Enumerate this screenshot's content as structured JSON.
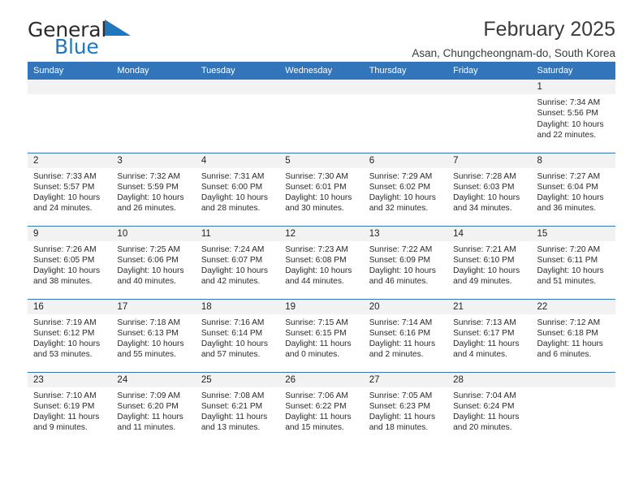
{
  "brand": {
    "name_part1": "General",
    "name_part2": "Blue",
    "triangle_color": "#1f77be",
    "text_color": "#2b2b2b"
  },
  "header": {
    "title": "February 2025",
    "subtitle": "Asan, Chungcheongnam-do, South Korea"
  },
  "theme": {
    "header_blue": "#3275bb",
    "daynum_bg": "#f2f2f2",
    "row_divider": "#3275bb",
    "text": "#2a2a2a"
  },
  "calendar": {
    "weekday_headers": [
      "Sunday",
      "Monday",
      "Tuesday",
      "Wednesday",
      "Thursday",
      "Friday",
      "Saturday"
    ],
    "labels": {
      "sunrise": "Sunrise:",
      "sunset": "Sunset:",
      "daylight": "Daylight:"
    },
    "weeks": [
      [
        {
          "day": "",
          "blank": true
        },
        {
          "day": "",
          "blank": true
        },
        {
          "day": "",
          "blank": true
        },
        {
          "day": "",
          "blank": true
        },
        {
          "day": "",
          "blank": true
        },
        {
          "day": "",
          "blank": true
        },
        {
          "day": "1",
          "sunrise": "Sunrise: 7:34 AM",
          "sunset": "Sunset: 5:56 PM",
          "daylight1": "Daylight: 10 hours",
          "daylight2": "and 22 minutes."
        }
      ],
      [
        {
          "day": "2",
          "sunrise": "Sunrise: 7:33 AM",
          "sunset": "Sunset: 5:57 PM",
          "daylight1": "Daylight: 10 hours",
          "daylight2": "and 24 minutes."
        },
        {
          "day": "3",
          "sunrise": "Sunrise: 7:32 AM",
          "sunset": "Sunset: 5:59 PM",
          "daylight1": "Daylight: 10 hours",
          "daylight2": "and 26 minutes."
        },
        {
          "day": "4",
          "sunrise": "Sunrise: 7:31 AM",
          "sunset": "Sunset: 6:00 PM",
          "daylight1": "Daylight: 10 hours",
          "daylight2": "and 28 minutes."
        },
        {
          "day": "5",
          "sunrise": "Sunrise: 7:30 AM",
          "sunset": "Sunset: 6:01 PM",
          "daylight1": "Daylight: 10 hours",
          "daylight2": "and 30 minutes."
        },
        {
          "day": "6",
          "sunrise": "Sunrise: 7:29 AM",
          "sunset": "Sunset: 6:02 PM",
          "daylight1": "Daylight: 10 hours",
          "daylight2": "and 32 minutes."
        },
        {
          "day": "7",
          "sunrise": "Sunrise: 7:28 AM",
          "sunset": "Sunset: 6:03 PM",
          "daylight1": "Daylight: 10 hours",
          "daylight2": "and 34 minutes."
        },
        {
          "day": "8",
          "sunrise": "Sunrise: 7:27 AM",
          "sunset": "Sunset: 6:04 PM",
          "daylight1": "Daylight: 10 hours",
          "daylight2": "and 36 minutes."
        }
      ],
      [
        {
          "day": "9",
          "sunrise": "Sunrise: 7:26 AM",
          "sunset": "Sunset: 6:05 PM",
          "daylight1": "Daylight: 10 hours",
          "daylight2": "and 38 minutes."
        },
        {
          "day": "10",
          "sunrise": "Sunrise: 7:25 AM",
          "sunset": "Sunset: 6:06 PM",
          "daylight1": "Daylight: 10 hours",
          "daylight2": "and 40 minutes."
        },
        {
          "day": "11",
          "sunrise": "Sunrise: 7:24 AM",
          "sunset": "Sunset: 6:07 PM",
          "daylight1": "Daylight: 10 hours",
          "daylight2": "and 42 minutes."
        },
        {
          "day": "12",
          "sunrise": "Sunrise: 7:23 AM",
          "sunset": "Sunset: 6:08 PM",
          "daylight1": "Daylight: 10 hours",
          "daylight2": "and 44 minutes."
        },
        {
          "day": "13",
          "sunrise": "Sunrise: 7:22 AM",
          "sunset": "Sunset: 6:09 PM",
          "daylight1": "Daylight: 10 hours",
          "daylight2": "and 46 minutes."
        },
        {
          "day": "14",
          "sunrise": "Sunrise: 7:21 AM",
          "sunset": "Sunset: 6:10 PM",
          "daylight1": "Daylight: 10 hours",
          "daylight2": "and 49 minutes."
        },
        {
          "day": "15",
          "sunrise": "Sunrise: 7:20 AM",
          "sunset": "Sunset: 6:11 PM",
          "daylight1": "Daylight: 10 hours",
          "daylight2": "and 51 minutes."
        }
      ],
      [
        {
          "day": "16",
          "sunrise": "Sunrise: 7:19 AM",
          "sunset": "Sunset: 6:12 PM",
          "daylight1": "Daylight: 10 hours",
          "daylight2": "and 53 minutes."
        },
        {
          "day": "17",
          "sunrise": "Sunrise: 7:18 AM",
          "sunset": "Sunset: 6:13 PM",
          "daylight1": "Daylight: 10 hours",
          "daylight2": "and 55 minutes."
        },
        {
          "day": "18",
          "sunrise": "Sunrise: 7:16 AM",
          "sunset": "Sunset: 6:14 PM",
          "daylight1": "Daylight: 10 hours",
          "daylight2": "and 57 minutes."
        },
        {
          "day": "19",
          "sunrise": "Sunrise: 7:15 AM",
          "sunset": "Sunset: 6:15 PM",
          "daylight1": "Daylight: 11 hours",
          "daylight2": "and 0 minutes."
        },
        {
          "day": "20",
          "sunrise": "Sunrise: 7:14 AM",
          "sunset": "Sunset: 6:16 PM",
          "daylight1": "Daylight: 11 hours",
          "daylight2": "and 2 minutes."
        },
        {
          "day": "21",
          "sunrise": "Sunrise: 7:13 AM",
          "sunset": "Sunset: 6:17 PM",
          "daylight1": "Daylight: 11 hours",
          "daylight2": "and 4 minutes."
        },
        {
          "day": "22",
          "sunrise": "Sunrise: 7:12 AM",
          "sunset": "Sunset: 6:18 PM",
          "daylight1": "Daylight: 11 hours",
          "daylight2": "and 6 minutes."
        }
      ],
      [
        {
          "day": "23",
          "sunrise": "Sunrise: 7:10 AM",
          "sunset": "Sunset: 6:19 PM",
          "daylight1": "Daylight: 11 hours",
          "daylight2": "and 9 minutes."
        },
        {
          "day": "24",
          "sunrise": "Sunrise: 7:09 AM",
          "sunset": "Sunset: 6:20 PM",
          "daylight1": "Daylight: 11 hours",
          "daylight2": "and 11 minutes."
        },
        {
          "day": "25",
          "sunrise": "Sunrise: 7:08 AM",
          "sunset": "Sunset: 6:21 PM",
          "daylight1": "Daylight: 11 hours",
          "daylight2": "and 13 minutes."
        },
        {
          "day": "26",
          "sunrise": "Sunrise: 7:06 AM",
          "sunset": "Sunset: 6:22 PM",
          "daylight1": "Daylight: 11 hours",
          "daylight2": "and 15 minutes."
        },
        {
          "day": "27",
          "sunrise": "Sunrise: 7:05 AM",
          "sunset": "Sunset: 6:23 PM",
          "daylight1": "Daylight: 11 hours",
          "daylight2": "and 18 minutes."
        },
        {
          "day": "28",
          "sunrise": "Sunrise: 7:04 AM",
          "sunset": "Sunset: 6:24 PM",
          "daylight1": "Daylight: 11 hours",
          "daylight2": "and 20 minutes."
        },
        {
          "day": "",
          "blank": true
        }
      ]
    ]
  }
}
